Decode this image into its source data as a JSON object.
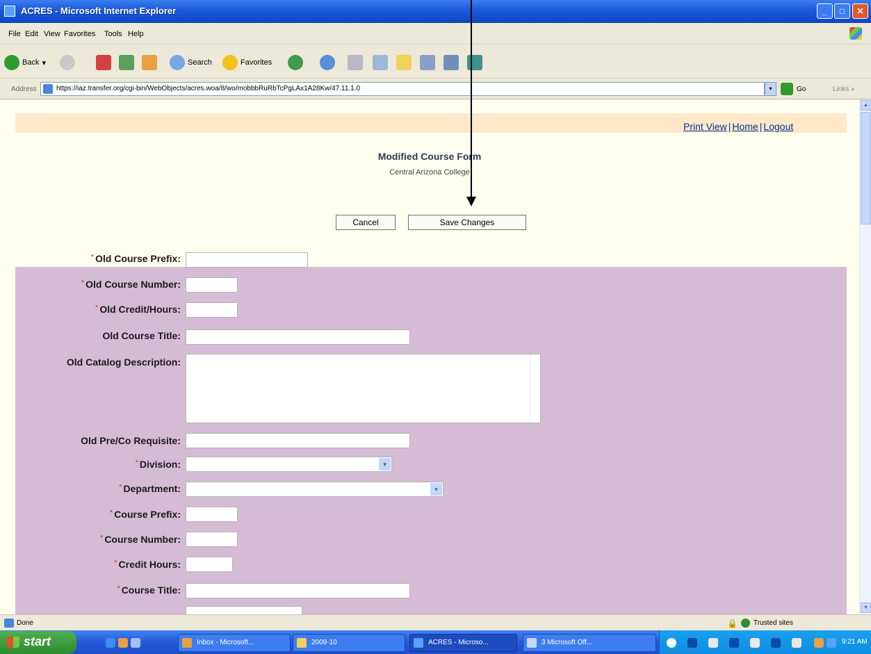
{
  "window": {
    "title": "ACRES - Microsoft Internet Explorer",
    "minimize": "_",
    "maximize": "□",
    "close": "✕"
  },
  "menu": [
    "File",
    "Edit",
    "View",
    "Favorites",
    "Tools",
    "Help"
  ],
  "toolbar": {
    "back_label": "Back",
    "back_arrow": "▾",
    "search_label": "Search",
    "favorites_label": "Favorites"
  },
  "address": {
    "label": "Address",
    "url": "https://iaz.transfer.org/cgi-bin/WebObjects/acres.woa/8/wo/mobbbRuRbTcPgLAx1A28Kw/47.11.1.0",
    "dropdown": "▾",
    "go_label": "Go",
    "links_label": "Links",
    "links_chevron": "»"
  },
  "page": {
    "top_links": {
      "print_view": "Print View",
      "home": "Home",
      "logout": "Logout",
      "separator": "|"
    },
    "form_title": "Modified Course Form",
    "college": "Central Arizona College",
    "cancel_label": "Cancel",
    "save_label": "Save Changes",
    "required_marker": "*",
    "fields": {
      "old_course_prefix": "Old Course Prefix:",
      "old_course_number": "Old Course Number:",
      "old_credit_hours": "Old Credit/Hours:",
      "old_course_title": "Old Course Title:",
      "old_catalog_description": "Old Catalog Description:",
      "old_pre_co_requisite": "Old Pre/Co Requisite:",
      "division": "Division:",
      "department": "Department:",
      "course_prefix": "Course Prefix:",
      "course_number": "Course Number:",
      "credit_hours": "Credit Hours:",
      "course_title": "Course Title:"
    },
    "select_arrow": "▾"
  },
  "scrollbar": {
    "up": "▲",
    "down": "▼"
  },
  "status": {
    "text": "Done",
    "zone": "Trusted sites"
  },
  "taskbar": {
    "start_label": "start",
    "tasks": [
      "Inbox - Microsoft...",
      "2009-10",
      "ACRES - Microso...",
      "3 Microsoft Off..."
    ],
    "clock": "9:21 AM"
  },
  "colors": {
    "page_background": "#fffff0",
    "header_strip": "#ffe8c9",
    "form_panel": "#d4bcd4",
    "link": "#003399",
    "required": "#d03030"
  }
}
